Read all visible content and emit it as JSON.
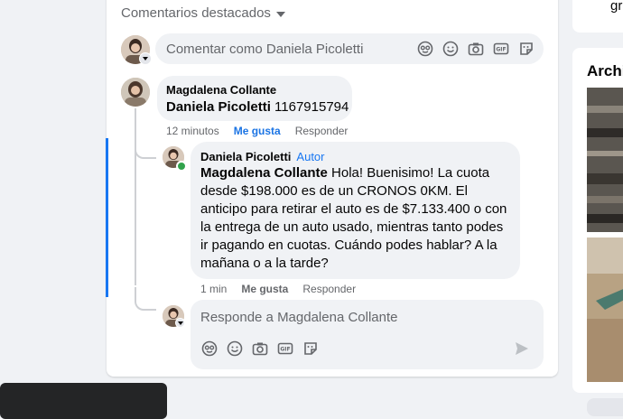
{
  "section": {
    "title": "Comentarios destacados"
  },
  "top_composer": {
    "placeholder": "Comentar como Daniela Picoletti"
  },
  "comment": {
    "author": "Magdalena Collante",
    "tag": "Daniela Picoletti",
    "text": " 1167915794",
    "time": "12 minutos",
    "like": "Me gusta",
    "reply": "Responder"
  },
  "reply": {
    "author": "Daniela Picoletti",
    "badge": "Autor",
    "tag": "Magdalena Collante",
    "text": " Hola! Buenisimo! La cuota desde $198.000 es de un CRONOS 0KM. El anticipo para retirar el auto es de $7.133.400 o con la entrega de un auto usado, mientras tanto podes ir pagando en cuotas. Cuándo podes hablar? A la mañana o a la tarde?",
    "time": "1 min",
    "like": "Me gusta",
    "reply": "Responder"
  },
  "reply_composer": {
    "placeholder": "Responde a Magdalena Collante"
  },
  "sidebar": {
    "fragment_top": "gr",
    "heading": "Archi"
  },
  "composer_icons": [
    "avatar-sticker-icon",
    "emoji-icon",
    "camera-icon",
    "gif-icon",
    "sticker-icon"
  ],
  "colors": {
    "link_blue": "#1877f2",
    "liked_blue": "#1b74e4",
    "online_green": "#31a24c"
  }
}
